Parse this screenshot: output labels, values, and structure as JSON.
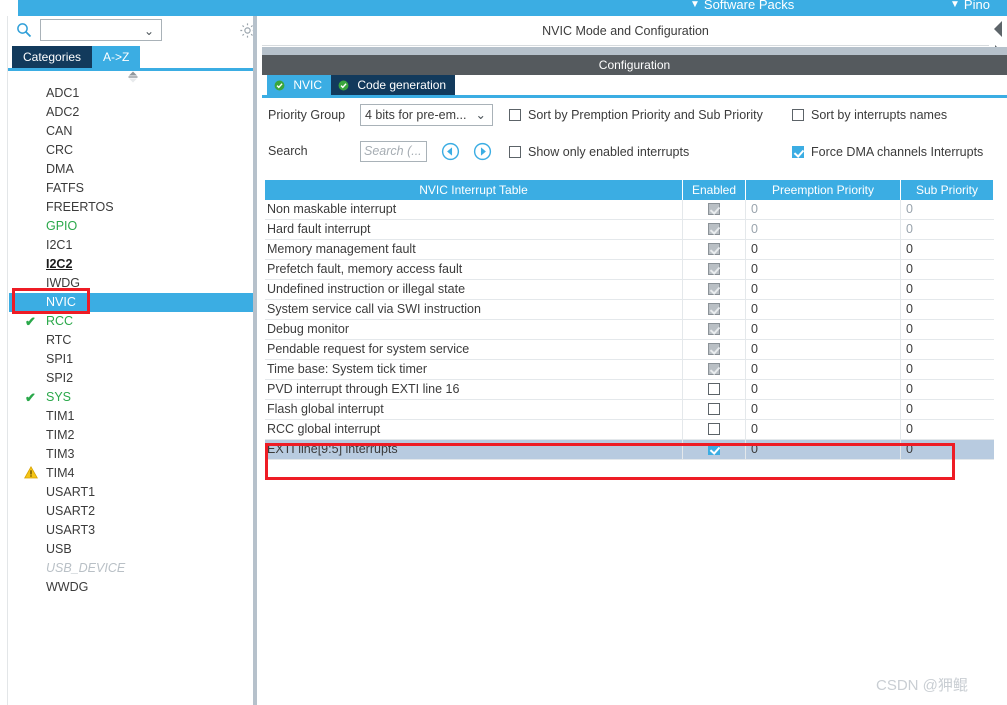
{
  "topbar": {
    "software_packs": "Software Packs",
    "pinout": "Pino",
    "chevron": "⌄"
  },
  "sidebar": {
    "search_placeholder": "",
    "search_value": "",
    "search_icon": "search-icon",
    "gear_icon": "gear-icon",
    "tabs": [
      {
        "label": "Categories",
        "active": false
      },
      {
        "label": "A->Z",
        "active": true
      }
    ],
    "items": [
      {
        "label": "ADC1",
        "state": "normal"
      },
      {
        "label": "ADC2",
        "state": "normal"
      },
      {
        "label": "CAN",
        "state": "normal"
      },
      {
        "label": "CRC",
        "state": "normal"
      },
      {
        "label": "DMA",
        "state": "normal"
      },
      {
        "label": "FATFS",
        "state": "normal"
      },
      {
        "label": "FREERTOS",
        "state": "normal"
      },
      {
        "label": "GPIO",
        "state": "green"
      },
      {
        "label": "I2C1",
        "state": "normal"
      },
      {
        "label": "I2C2",
        "state": "bold"
      },
      {
        "label": "IWDG",
        "state": "normal"
      },
      {
        "label": "NVIC",
        "state": "selected"
      },
      {
        "label": "RCC",
        "state": "green",
        "mark": "check"
      },
      {
        "label": "RTC",
        "state": "normal"
      },
      {
        "label": "SPI1",
        "state": "normal"
      },
      {
        "label": "SPI2",
        "state": "normal"
      },
      {
        "label": "SYS",
        "state": "green",
        "mark": "check"
      },
      {
        "label": "TIM1",
        "state": "normal"
      },
      {
        "label": "TIM2",
        "state": "normal"
      },
      {
        "label": "TIM3",
        "state": "normal"
      },
      {
        "label": "TIM4",
        "state": "normal",
        "mark": "warning"
      },
      {
        "label": "USART1",
        "state": "normal"
      },
      {
        "label": "USART2",
        "state": "normal"
      },
      {
        "label": "USART3",
        "state": "normal"
      },
      {
        "label": "USB",
        "state": "normal"
      },
      {
        "label": "USB_DEVICE",
        "state": "disabled"
      },
      {
        "label": "WWDG",
        "state": "normal"
      }
    ]
  },
  "main": {
    "mode_title": "NVIC Mode and Configuration",
    "configuration_label": "Configuration",
    "tabs": [
      {
        "label": "NVIC",
        "active": true,
        "icon": "check-circle-icon"
      },
      {
        "label": "Code generation",
        "active": false,
        "icon": "check-circle-icon"
      }
    ],
    "priority_group_label": "Priority Group",
    "priority_group_value": "4 bits for pre-em...",
    "search_label": "Search",
    "search_placeholder": "Search (...",
    "search_value": "",
    "nav_prev_icon": "chevron-left-circle-icon",
    "nav_next_icon": "chevron-right-circle-icon",
    "checkboxes": [
      {
        "label": "Sort by Premption Priority and Sub Priority",
        "checked": false
      },
      {
        "label": "Sort by interrupts names",
        "checked": false
      },
      {
        "label": "Show only enabled interrupts",
        "checked": false
      },
      {
        "label": "Force DMA channels Interrupts",
        "checked": true
      }
    ]
  },
  "table": {
    "headers": [
      "NVIC Interrupt Table",
      "Enabled",
      "Preemption Priority",
      "Sub Priority"
    ],
    "rows": [
      {
        "name": "Non maskable interrupt",
        "enabled": "disabled-checked",
        "preemption": "0",
        "sub": "0",
        "dim": true,
        "selected": false
      },
      {
        "name": "Hard fault interrupt",
        "enabled": "disabled-checked",
        "preemption": "0",
        "sub": "0",
        "dim": true,
        "selected": false
      },
      {
        "name": "Memory management fault",
        "enabled": "disabled-checked",
        "preemption": "0",
        "sub": "0",
        "dim": false,
        "selected": false
      },
      {
        "name": "Prefetch fault, memory access fault",
        "enabled": "disabled-checked",
        "preemption": "0",
        "sub": "0",
        "dim": false,
        "selected": false
      },
      {
        "name": "Undefined instruction or illegal state",
        "enabled": "disabled-checked",
        "preemption": "0",
        "sub": "0",
        "dim": false,
        "selected": false
      },
      {
        "name": "System service call via SWI instruction",
        "enabled": "disabled-checked",
        "preemption": "0",
        "sub": "0",
        "dim": false,
        "selected": false
      },
      {
        "name": "Debug monitor",
        "enabled": "disabled-checked",
        "preemption": "0",
        "sub": "0",
        "dim": false,
        "selected": false
      },
      {
        "name": "Pendable request for system service",
        "enabled": "disabled-checked",
        "preemption": "0",
        "sub": "0",
        "dim": false,
        "selected": false
      },
      {
        "name": "Time base: System tick timer",
        "enabled": "disabled-checked",
        "preemption": "0",
        "sub": "0",
        "dim": false,
        "selected": false
      },
      {
        "name": "PVD interrupt through EXTI line 16",
        "enabled": "unchecked",
        "preemption": "0",
        "sub": "0",
        "dim": false,
        "selected": false
      },
      {
        "name": "Flash global interrupt",
        "enabled": "unchecked",
        "preemption": "0",
        "sub": "0",
        "dim": false,
        "selected": false
      },
      {
        "name": "RCC global interrupt",
        "enabled": "unchecked",
        "preemption": "0",
        "sub": "0",
        "dim": false,
        "selected": false
      },
      {
        "name": "EXTI line[9:5] interrupts",
        "enabled": "checked",
        "preemption": "0",
        "sub": "0",
        "dim": false,
        "selected": true
      }
    ]
  },
  "annotations": {
    "nvic_box_color": "#ee1c25",
    "row_box_color": "#ee1c25"
  },
  "watermark": "CSDN @狎鲲",
  "colors": {
    "accent_blue": "#3bade3",
    "dark_navy": "#123a5c",
    "selection_blue": "#b8cbe0",
    "green": "#2aa84a",
    "warning_yellow": "#f5c518"
  }
}
